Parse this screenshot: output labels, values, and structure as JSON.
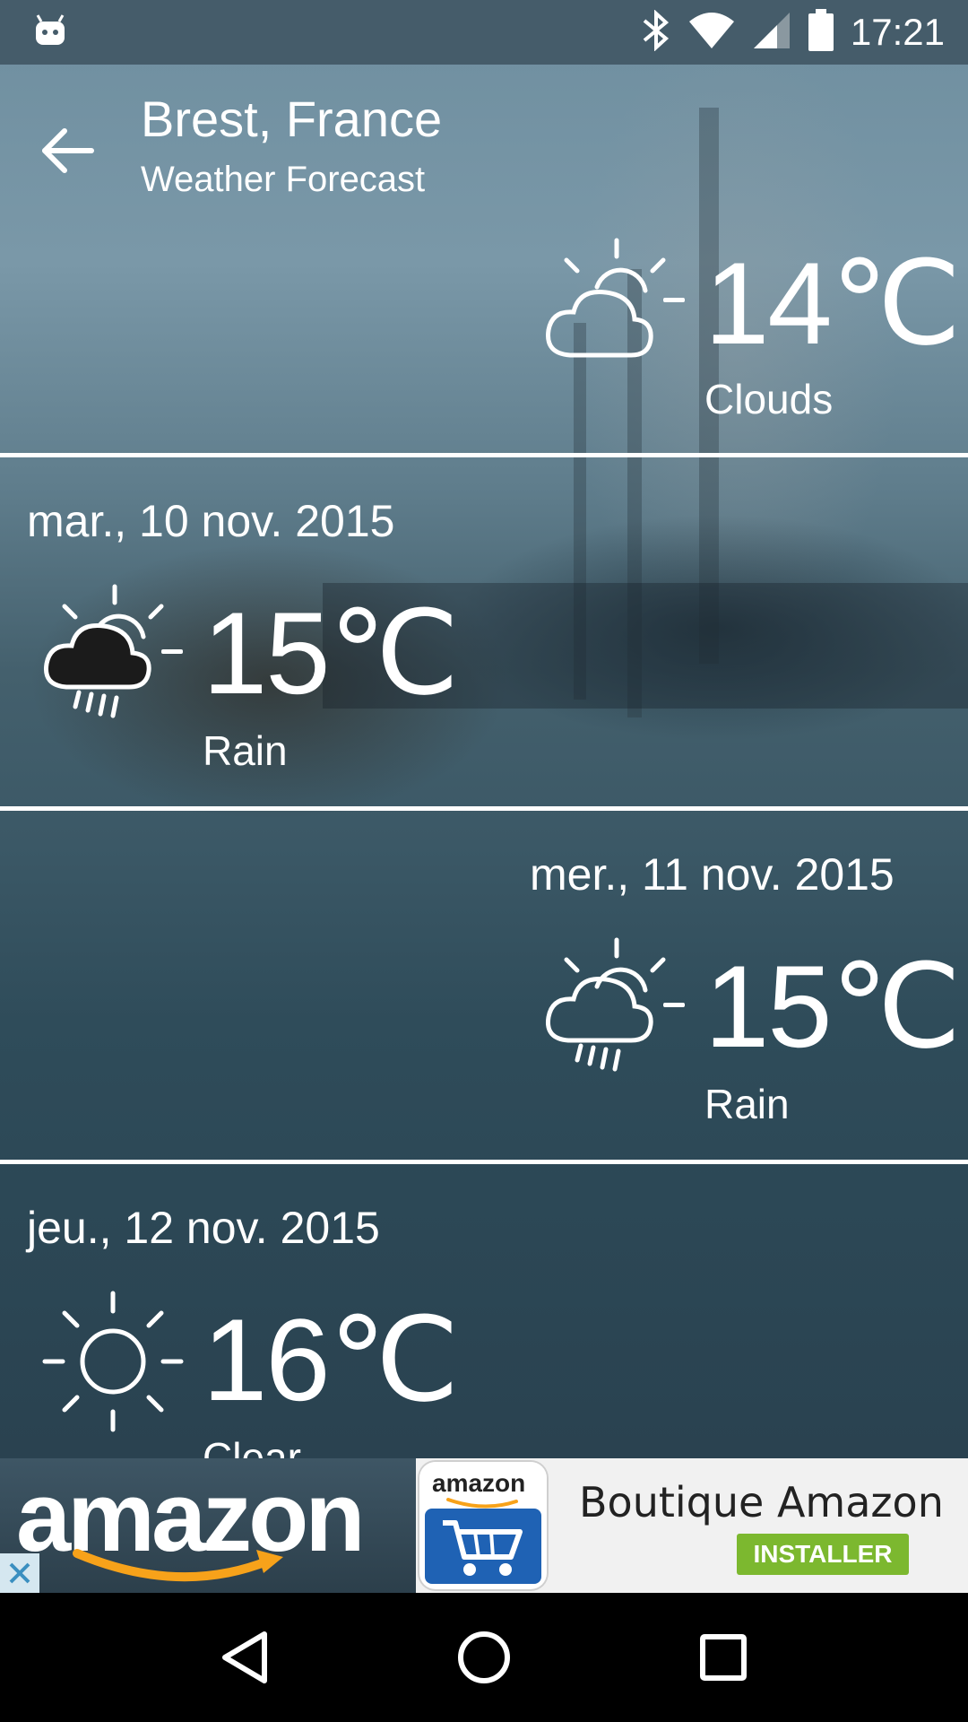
{
  "status_bar": {
    "time": "17:21",
    "icons": [
      "android-icon",
      "bluetooth-icon",
      "wifi-icon",
      "cell-signal-icon",
      "battery-icon"
    ]
  },
  "header": {
    "city": "Brest, France",
    "subtitle": "Weather Forecast",
    "back_icon": "arrow-left-icon"
  },
  "current": {
    "temp": "14℃",
    "condition": "Clouds",
    "icon": "partly-cloudy-icon"
  },
  "forecast": [
    {
      "date": "mar., 10 nov. 2015",
      "temp": "15℃",
      "condition": "Rain",
      "icon": "rain-icon"
    },
    {
      "date": "mer., 11 nov. 2015",
      "temp": "15℃",
      "condition": "Rain",
      "icon": "rain-icon"
    },
    {
      "date": "jeu., 12 nov. 2015",
      "temp": "16℃",
      "condition": "Clear",
      "icon": "sun-icon"
    }
  ],
  "ad": {
    "logo_text": "amazon",
    "app_icon_text": "amazon",
    "title": "Boutique Amazon",
    "install_label": "INSTALLER",
    "colors": {
      "install": "#7cb82f",
      "smile": "#f7a21a",
      "app_icon_blue": "#1f62b4"
    }
  },
  "navbar": {
    "icons": [
      "back-triangle-icon",
      "home-circle-icon",
      "recents-square-icon"
    ]
  }
}
